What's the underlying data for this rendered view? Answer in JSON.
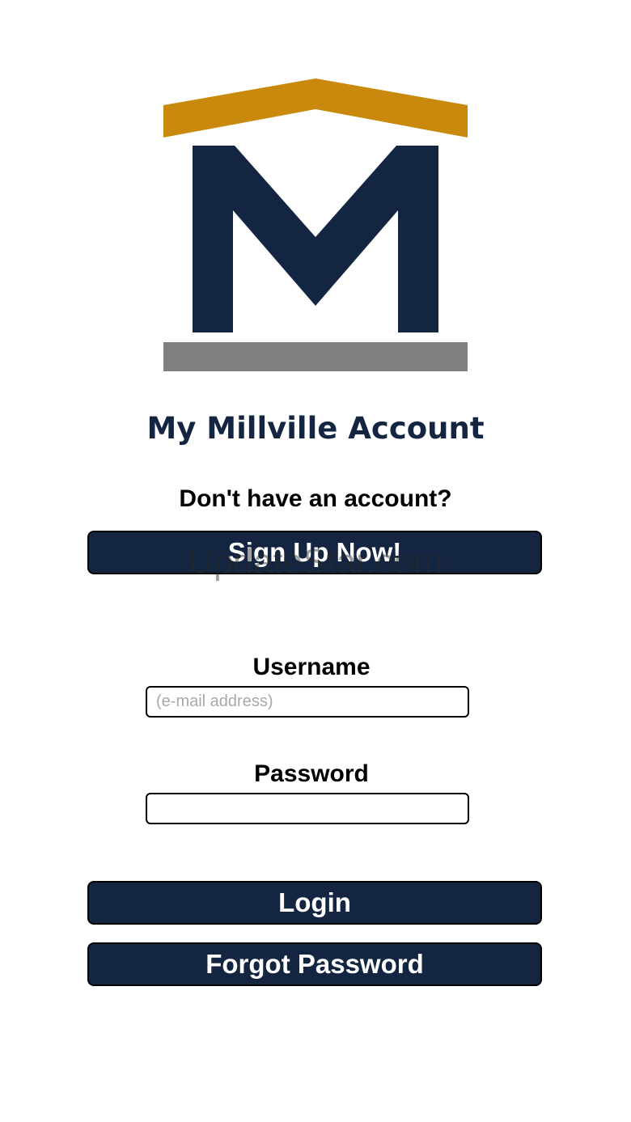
{
  "brand": {
    "title": "My Millville Account",
    "colors": {
      "navy": "#132541",
      "gold": "#c8890c",
      "gray": "#808080"
    }
  },
  "signup": {
    "prompt": "Don't have an account?",
    "button_label": "Sign Up Now!"
  },
  "watermark": "UpdateStar.com",
  "login_form": {
    "username_label": "Username",
    "username_placeholder": "(e-mail address)",
    "username_value": "",
    "password_label": "Password",
    "password_value": "",
    "login_label": "Login",
    "forgot_label": "Forgot Password"
  }
}
